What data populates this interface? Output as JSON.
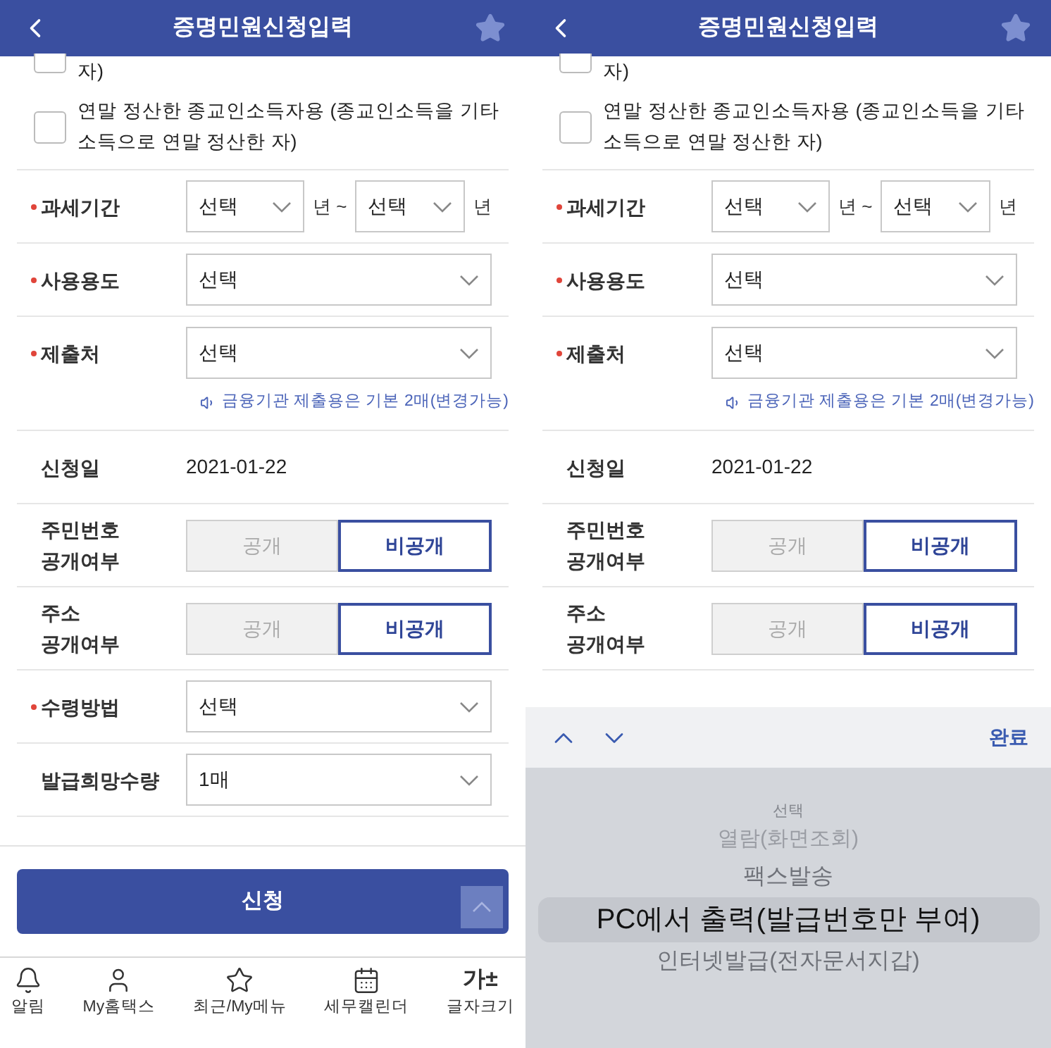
{
  "screens": [
    {
      "title": "증명민원신청입력",
      "checkboxes": [
        {
          "label": "자)",
          "checked": false,
          "cut": true
        },
        {
          "label": "연말 정산한 종교인소득자용 (종교인소득을 기타소득으로 연말 정산한 자)",
          "checked": false
        }
      ],
      "fields": [
        {
          "kind": "range",
          "label": "과세기간",
          "required": true,
          "from": "선택",
          "sep": "년 ~",
          "to": "선택",
          "unit": "년"
        },
        {
          "kind": "select",
          "label": "사용용도",
          "required": true,
          "value": "선택"
        },
        {
          "kind": "select",
          "label": "제출처",
          "required": true,
          "value": "선택",
          "note": "금융기관 제출용은 기본 2매(변경가능)"
        },
        {
          "kind": "static",
          "label": "신청일",
          "required": false,
          "value": "2021-01-22"
        },
        {
          "kind": "toggle",
          "label": "주민번호\n공개여부",
          "required": false,
          "options": [
            {
              "label": "공개",
              "selected": false
            },
            {
              "label": "비공개",
              "selected": true
            }
          ]
        },
        {
          "kind": "toggle",
          "label": "주소\n공개여부",
          "required": false,
          "options": [
            {
              "label": "공개",
              "selected": false
            },
            {
              "label": "비공개",
              "selected": true
            }
          ]
        },
        {
          "kind": "select",
          "label": "수령방법",
          "required": true,
          "value": "선택"
        },
        {
          "kind": "select",
          "label": "발급희망수량",
          "required": false,
          "value": "1매"
        }
      ],
      "submit": "신청",
      "nav": [
        {
          "label": "알림"
        },
        {
          "label": "My홈택스"
        },
        {
          "label": "최근/My메뉴"
        },
        {
          "label": "세무캘린더"
        },
        {
          "icon_text": "가±",
          "label": "글자크기"
        }
      ]
    },
    {
      "title": "증명민원신청입력",
      "checkboxes": [
        {
          "label": "자)",
          "checked": false,
          "cut": true
        },
        {
          "label": "연말 정산한 종교인소득자용 (종교인소득을 기타소득으로 연말 정산한 자)",
          "checked": false
        }
      ],
      "fields": [
        {
          "kind": "range",
          "label": "과세기간",
          "required": true,
          "from": "선택",
          "sep": "년 ~",
          "to": "선택",
          "unit": "년"
        },
        {
          "kind": "select",
          "label": "사용용도",
          "required": true,
          "value": "선택"
        },
        {
          "kind": "select",
          "label": "제출처",
          "required": true,
          "value": "선택",
          "note": "금융기관 제출용은 기본 2매(변경가능)"
        },
        {
          "kind": "static",
          "label": "신청일",
          "required": false,
          "value": "2021-01-22"
        },
        {
          "kind": "toggle",
          "label": "주민번호\n공개여부",
          "required": false,
          "options": [
            {
              "label": "공개",
              "selected": false
            },
            {
              "label": "비공개",
              "selected": true
            }
          ]
        },
        {
          "kind": "toggle",
          "label": "주소\n공개여부",
          "required": false,
          "options": [
            {
              "label": "공개",
              "selected": false
            },
            {
              "label": "비공개",
              "selected": true
            }
          ]
        }
      ],
      "picker": {
        "done": "완료",
        "options": [
          {
            "label": "선택",
            "selected": false
          },
          {
            "label": "열람(화면조회)",
            "selected": false
          },
          {
            "label": "팩스발송",
            "selected": false
          },
          {
            "label": "PC에서 출력(발급번호만 부여)",
            "selected": true
          },
          {
            "label": "인터넷발급(전자문서지갑)",
            "selected": false
          }
        ]
      }
    }
  ]
}
